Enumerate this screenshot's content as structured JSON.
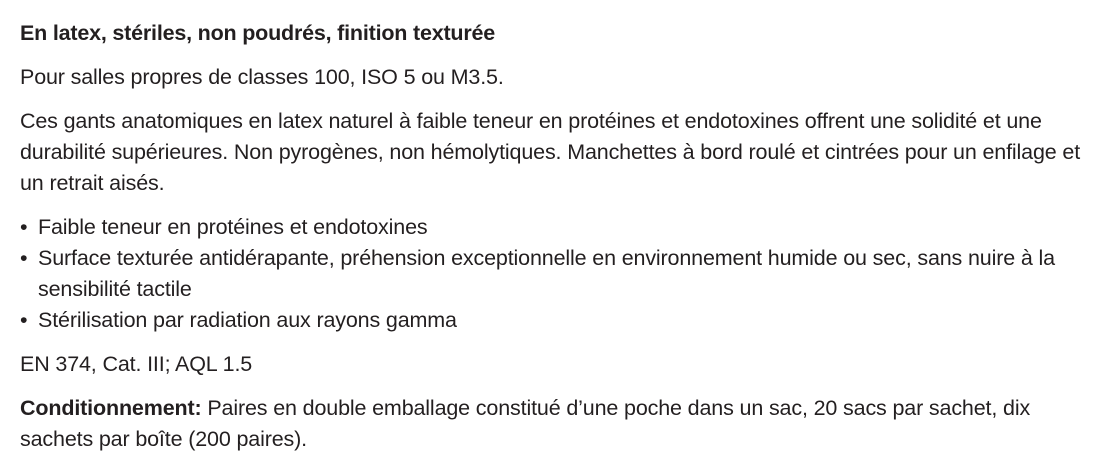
{
  "heading": "En latex, stériles, non poudrés, finition texturée",
  "subtitle": "Pour salles propres de classes 100, ISO 5 ou M3.5.",
  "description": "Ces gants anatomiques en latex naturel à faible teneur en protéines et endotoxines offrent une solidité et une durabilité supérieures. Non pyrogènes, non hémolytiques. Manchettes à bord roulé et cintrées pour un enfilage et un retrait aisés.",
  "bullet_symbol": "•",
  "features": [
    "Faible teneur en protéines et endotoxines",
    "Surface texturée antidérapante, préhension exceptionnelle en environnement humide ou sec, sans nuire à la sensibilité tactile",
    "Stérilisation par radiation aux rayons gamma"
  ],
  "norms": "EN 374, Cat. III; AQL 1.5",
  "packaging": {
    "label": "Conditionnement:",
    "text": " Paires en double emballage constitué d’une poche dans un sac, 20 sacs par sachet, dix sachets par boîte (200 paires)."
  }
}
